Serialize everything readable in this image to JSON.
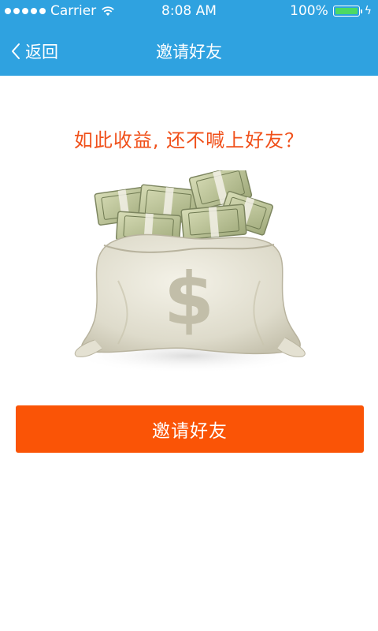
{
  "status_bar": {
    "carrier": "Carrier",
    "time": "8:08 AM",
    "battery": "100%"
  },
  "nav": {
    "back_label": "返回",
    "title": "邀请好友"
  },
  "main": {
    "headline": "如此收益, 还不喊上好友？",
    "invite_button": "邀请好友"
  },
  "colors": {
    "nav_bg": "#2fa2e0",
    "accent": "#fa5406",
    "headline": "#f0501a"
  }
}
